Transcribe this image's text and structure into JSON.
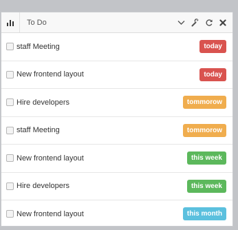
{
  "header": {
    "title": "To Do",
    "icons": [
      "bar-chart-icon",
      "chevron-down-icon",
      "wrench-icon",
      "refresh-icon",
      "close-icon"
    ]
  },
  "colors": {
    "today": "#d9534f",
    "tommorow": "#f0ad4e",
    "this_week": "#5cb85c",
    "this_month": "#5bc0de"
  },
  "items": [
    {
      "label": "staff Meeting",
      "badge": "today",
      "color": "#d9534f"
    },
    {
      "label": "New frontend layout",
      "badge": "today",
      "color": "#d9534f"
    },
    {
      "label": "Hire developers",
      "badge": "tommorow",
      "color": "#f0ad4e"
    },
    {
      "label": "staff Meeting",
      "badge": "tommorow",
      "color": "#f0ad4e"
    },
    {
      "label": "New frontend layout",
      "badge": "this week",
      "color": "#5cb85c"
    },
    {
      "label": "Hire developers",
      "badge": "this week",
      "color": "#5cb85c"
    },
    {
      "label": "New frontend layout",
      "badge": "this month",
      "color": "#5bc0de"
    }
  ]
}
